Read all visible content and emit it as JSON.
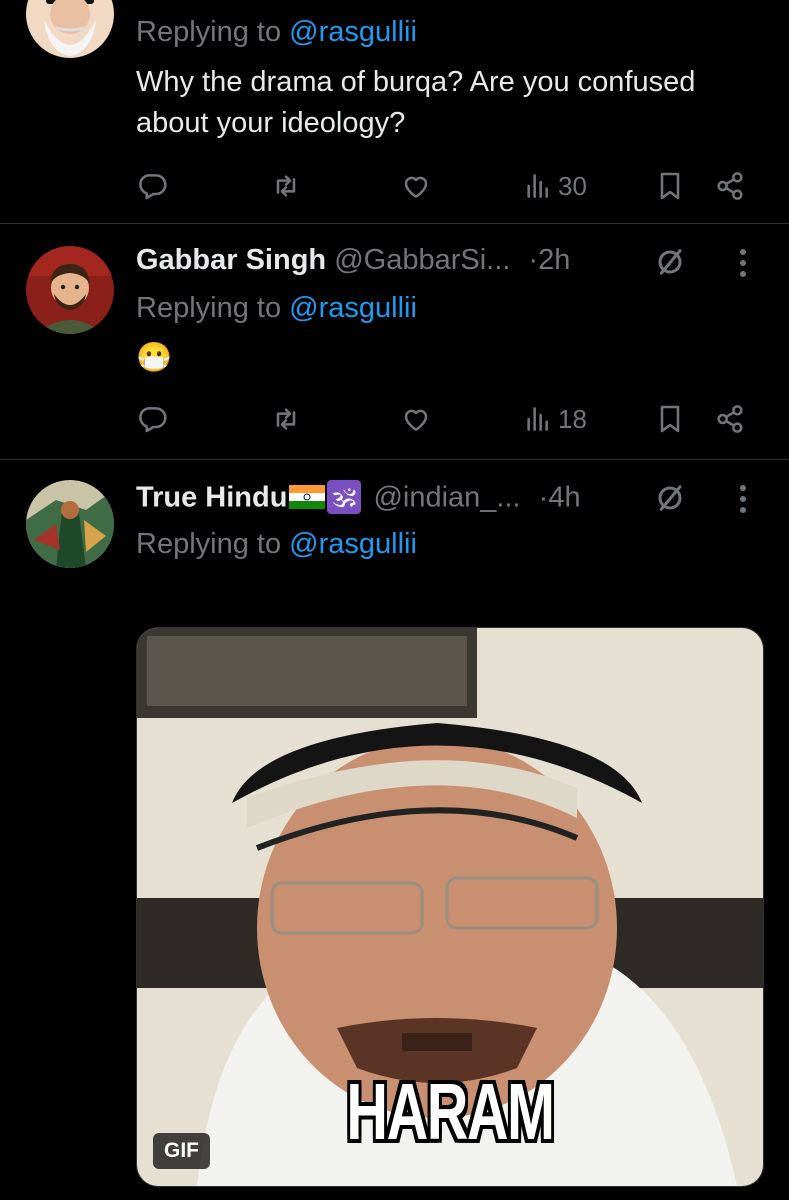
{
  "tweets": [
    {
      "replying_prefix": "Replying to",
      "replying_to": "@rasgullii",
      "text": "Why the drama of burqa? Are you confused about your ideology?",
      "views": "30"
    },
    {
      "name": "Gabbar Singh",
      "handle": "@GabbarSi...",
      "separator": "·",
      "time": "2h",
      "replying_prefix": "Replying to",
      "replying_to": "@rasgullii",
      "text": "😷",
      "views": "18"
    },
    {
      "name": "True Hindu",
      "name_emoji": "🕉",
      "handle": "@indian_...",
      "separator": "·",
      "time": "4h",
      "replying_prefix": "Replying to",
      "replying_to": "@rasgullii",
      "media": {
        "caption": "HARAM",
        "badge": "GIF"
      }
    }
  ],
  "icons": {
    "reply": "reply-icon",
    "retweet": "retweet-icon",
    "like": "like-icon",
    "views": "views-icon",
    "bookmark": "bookmark-icon",
    "share": "share-icon",
    "grok": "grok-icon",
    "more": "more-icon"
  },
  "colors": {
    "background": "#000000",
    "text": "#e7e9ea",
    "muted": "#71767b",
    "link": "#1d9bf0",
    "divider": "#2f3336"
  }
}
